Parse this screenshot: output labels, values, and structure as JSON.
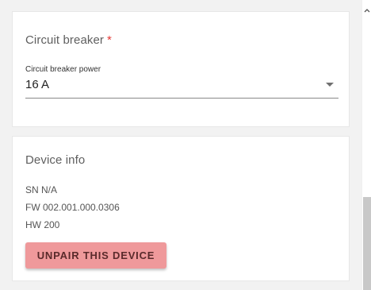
{
  "circuit_breaker": {
    "title": "Circuit breaker",
    "required_marker": "*",
    "field_label": "Circuit breaker power",
    "field_value": "16 A"
  },
  "device_info": {
    "title": "Device info",
    "sn": "SN N/A",
    "fw": "FW 002.001.000.0306",
    "hw": "HW 200",
    "unpair_label": "UNPAIR THIS DEVICE"
  },
  "colors": {
    "required": "#e53935",
    "unpair_button": "#ef999b",
    "scroll_thumb": "#c8c8c8"
  },
  "icons": {
    "dropdown": "chevron-down-icon",
    "scroll_up": "chevron-up-icon"
  }
}
